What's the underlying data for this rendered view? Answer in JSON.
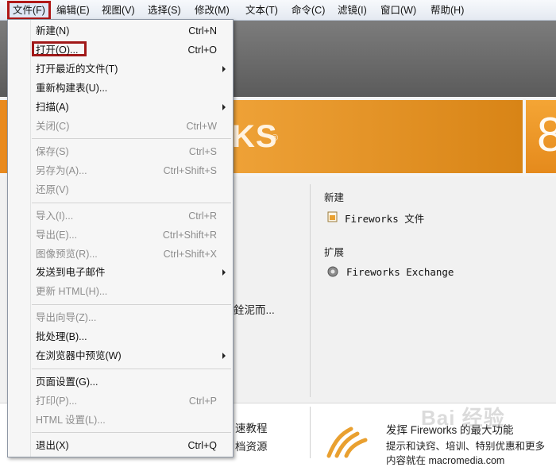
{
  "menubar": {
    "items": [
      {
        "label": "文件(F)",
        "active": true
      },
      {
        "label": "编辑(E)"
      },
      {
        "label": "视图(V)"
      },
      {
        "label": "选择(S)"
      },
      {
        "label": "修改(M)"
      },
      {
        "label": "文本(T)"
      },
      {
        "label": "命令(C)"
      },
      {
        "label": "滤镜(I)"
      },
      {
        "label": "窗口(W)"
      },
      {
        "label": "帮助(H)"
      }
    ]
  },
  "file_menu": {
    "items": [
      {
        "label": "新建(N)",
        "shortcut": "Ctrl+N",
        "enabled": true
      },
      {
        "label": "打开(O)...",
        "shortcut": "Ctrl+O",
        "enabled": true,
        "highlighted": true
      },
      {
        "label": "打开最近的文件(T)",
        "submenu": true,
        "enabled": true
      },
      {
        "label": "重新构建表(U)...",
        "enabled": true
      },
      {
        "label": "扫描(A)",
        "submenu": true,
        "enabled": true
      },
      {
        "label": "关闭(C)",
        "shortcut": "Ctrl+W",
        "enabled": false
      },
      {
        "label": "保存(S)",
        "shortcut": "Ctrl+S",
        "enabled": false
      },
      {
        "label": "另存为(A)...",
        "shortcut": "Ctrl+Shift+S",
        "enabled": false
      },
      {
        "label": "还原(V)",
        "enabled": false
      },
      {
        "label": "导入(I)...",
        "shortcut": "Ctrl+R",
        "enabled": false
      },
      {
        "label": "导出(E)...",
        "shortcut": "Ctrl+Shift+R",
        "enabled": false
      },
      {
        "label": "图像预览(R)...",
        "shortcut": "Ctrl+Shift+X",
        "enabled": false
      },
      {
        "label": "发送到电子邮件",
        "submenu": true,
        "enabled": true
      },
      {
        "label": "更新 HTML(H)...",
        "enabled": false
      },
      {
        "label": "导出向导(Z)...",
        "enabled": false
      },
      {
        "label": "批处理(B)...",
        "enabled": true
      },
      {
        "label": "在浏览器中预览(W)",
        "submenu": true,
        "enabled": true
      },
      {
        "label": "页面设置(G)...",
        "enabled": true
      },
      {
        "label": "打印(P)...",
        "shortcut": "Ctrl+P",
        "enabled": false
      },
      {
        "label": "HTML 设置(L)...",
        "enabled": false
      },
      {
        "label": "退出(X)",
        "shortcut": "Ctrl+Q",
        "enabled": true
      }
    ]
  },
  "banner": {
    "logo_text": "KS",
    "registered_mark": "®",
    "version": "8"
  },
  "start_page": {
    "create_new": {
      "title": "新建",
      "items": [
        {
          "label": "Fireworks 文件",
          "icon": "fireworks-file-icon"
        }
      ]
    },
    "extend": {
      "title": "扩展",
      "items": [
        {
          "label": "Fireworks Exchange",
          "icon": "exchange-icon"
        }
      ]
    },
    "partial_text_left": "銓泥而...",
    "bottom_left_line1": "速教程",
    "bottom_left_line2": "档资源",
    "bottom_right_line1": "发挥 Fireworks 的最大功能",
    "bottom_right_line2": "提示和诀窍、培训、特别优惠和更多",
    "bottom_right_line3": "内容就在 macromedia.com"
  },
  "watermark": "Bai 经验",
  "colors": {
    "highlight_border": "#a11818",
    "banner_orange": "#e98a1e",
    "disabled_text": "#8d8d8d"
  }
}
